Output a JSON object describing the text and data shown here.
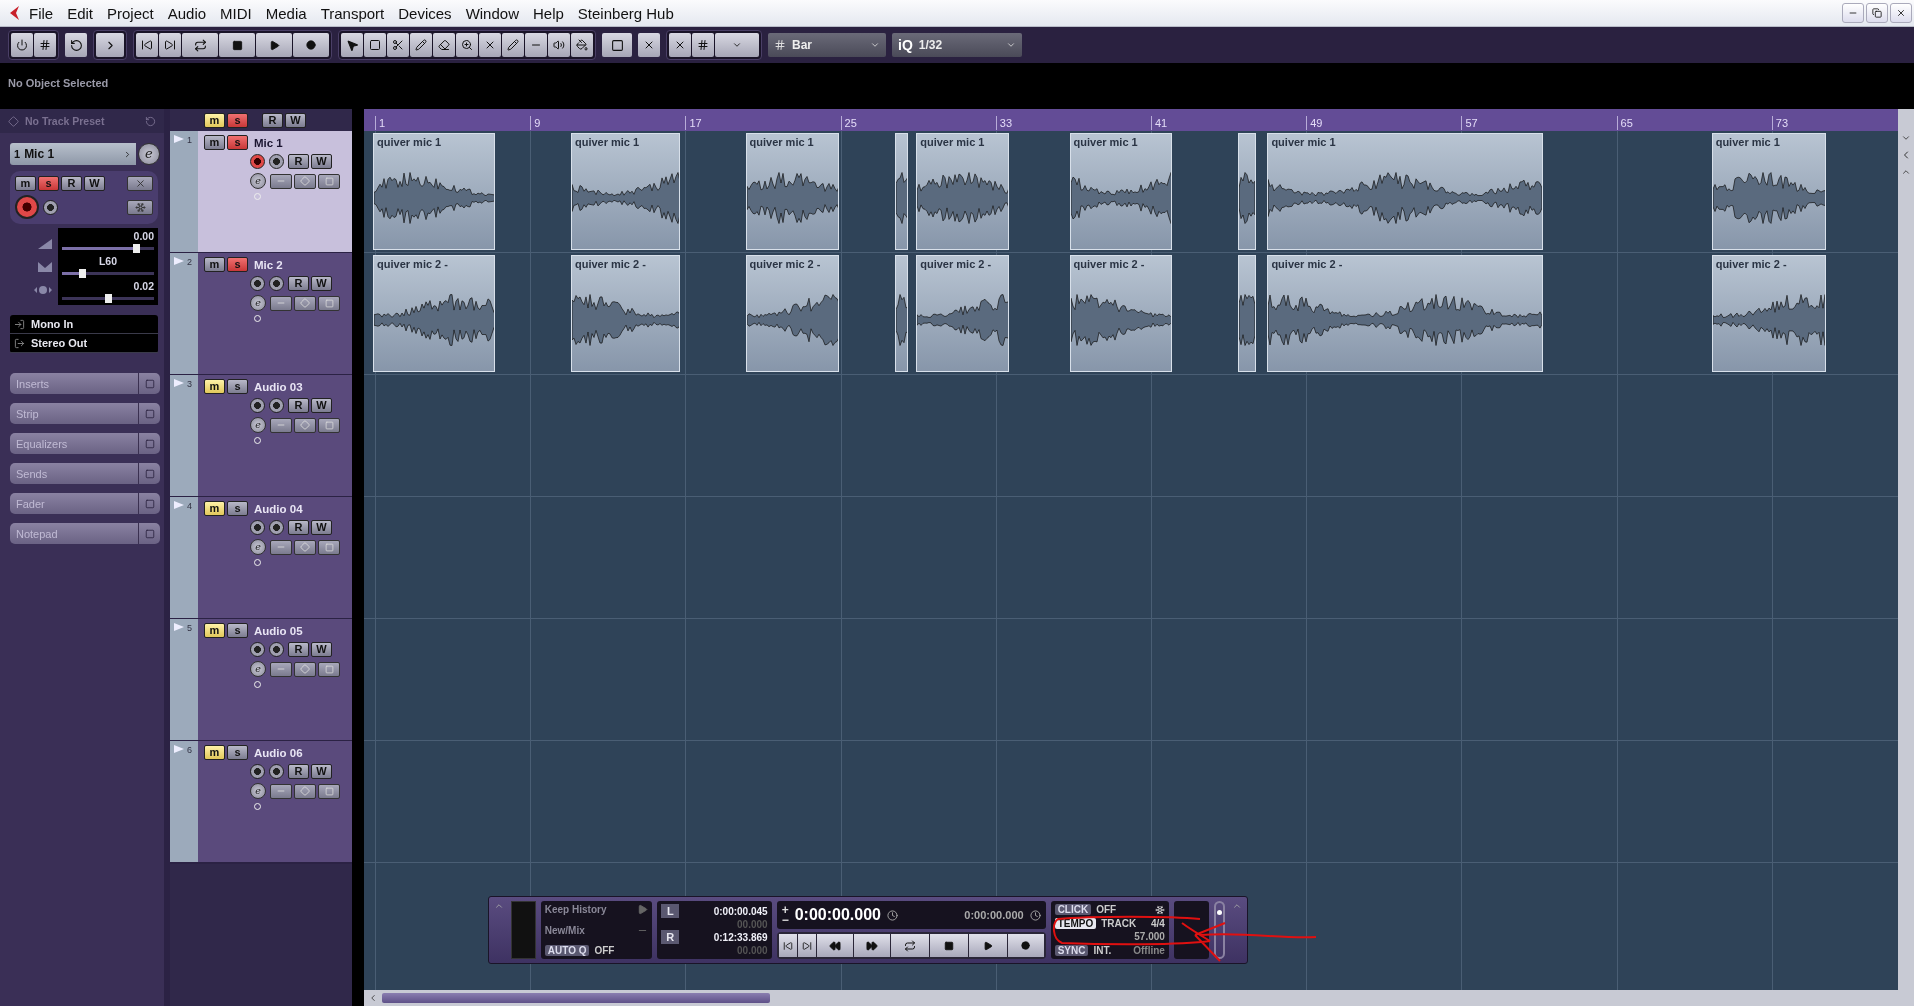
{
  "menu_bar": {
    "items": [
      "File",
      "Edit",
      "Project",
      "Audio",
      "MIDI",
      "Media",
      "Transport",
      "Devices",
      "Window",
      "Help",
      "Steinberg Hub"
    ]
  },
  "toolbar": {
    "snap_type": "Bar",
    "quantize_label": "iQ",
    "quantize": "1/32"
  },
  "info_line": {
    "text": "No Object Selected"
  },
  "inspector": {
    "preset": "No Track Preset",
    "track_number": "1",
    "track_name": "Mic 1",
    "edit_label": "e",
    "mute_label": "m",
    "solo_label": "s",
    "read_label": "R",
    "write_label": "W",
    "soloed": true,
    "record_enabled": true,
    "volume": {
      "reading": "0.00",
      "level": 0.8
    },
    "pan": {
      "reading": "L60",
      "level": 0.22
    },
    "delay": {
      "reading": "0.02",
      "level": 0.5
    },
    "input": "Mono In",
    "output": "Stereo Out",
    "sections": [
      "Inserts",
      "Strip",
      "Equalizers",
      "Sends",
      "Fader",
      "Notepad"
    ]
  },
  "track_list_header": {
    "mute_label": "m",
    "solo_label": "s",
    "read_label": "R",
    "write_label": "W",
    "muted": true,
    "soloed": true
  },
  "tracks": [
    {
      "number": "1",
      "name": "Mic 1",
      "selected": true,
      "muted": false,
      "soloed": true,
      "record_enabled": true,
      "mute_label": "m",
      "solo_label": "s",
      "read_label": "R",
      "write_label": "W",
      "edit_label": "e",
      "clips": [
        "quiver mic 1",
        "quiver mic 1",
        "quiver mic 1",
        "quiver mic 1",
        "quiver mic 1",
        "quiver mic 1",
        "quiver mic 1"
      ]
    },
    {
      "number": "2",
      "name": "Mic 2",
      "selected": false,
      "muted": false,
      "soloed": true,
      "record_enabled": false,
      "mute_label": "m",
      "solo_label": "s",
      "read_label": "R",
      "write_label": "W",
      "edit_label": "e",
      "clips": [
        "quiver mic 2 -",
        "quiver mic 2 -",
        "quiver mic 2 -",
        "quiver mic 2 -",
        "quiver mic 2 -",
        "quiver mic 2 -",
        "quiver mic 2 -"
      ]
    },
    {
      "number": "3",
      "name": "Audio 03",
      "selected": false,
      "muted": true,
      "soloed": false,
      "record_enabled": false,
      "mute_label": "m",
      "solo_label": "s",
      "read_label": "R",
      "write_label": "W",
      "edit_label": "e"
    },
    {
      "number": "4",
      "name": "Audio 04",
      "selected": false,
      "muted": true,
      "soloed": false,
      "record_enabled": false,
      "mute_label": "m",
      "solo_label": "s",
      "read_label": "R",
      "write_label": "W",
      "edit_label": "e"
    },
    {
      "number": "5",
      "name": "Audio 05",
      "selected": false,
      "muted": true,
      "soloed": false,
      "record_enabled": false,
      "mute_label": "m",
      "solo_label": "s",
      "read_label": "R",
      "write_label": "W",
      "edit_label": "e"
    },
    {
      "number": "6",
      "name": "Audio 06",
      "selected": false,
      "muted": true,
      "soloed": false,
      "record_enabled": false,
      "mute_label": "m",
      "solo_label": "s",
      "read_label": "R",
      "write_label": "W",
      "edit_label": "e"
    }
  ],
  "ruler": {
    "marks": [
      "1",
      "9",
      "17",
      "25",
      "33",
      "41",
      "49",
      "57",
      "65",
      "73"
    ]
  },
  "transport": {
    "history": {
      "keep": "Keep History",
      "mode": "New/Mix",
      "autoq_label": "AUTO Q",
      "autoq_value": "OFF"
    },
    "locators": {
      "left_label": "L",
      "left_time": "0:00:00.045",
      "left_sub": "00.000",
      "right_label": "R",
      "right_time": "0:12:33.869",
      "right_sub": "00.000"
    },
    "time": {
      "plus": "+",
      "minus": "−",
      "primary": "0:00:00.000",
      "secondary": "0:00:00.000"
    },
    "click": {
      "label": "CLICK",
      "value": "OFF"
    },
    "tempo": {
      "label": "TEMPO",
      "mode": "TRACK",
      "signature": "4/4",
      "bpm": "57.000"
    },
    "sync": {
      "label": "SYNC",
      "source": "INT.",
      "status": "Offline"
    },
    "jog": {
      "level": 0.85
    }
  }
}
